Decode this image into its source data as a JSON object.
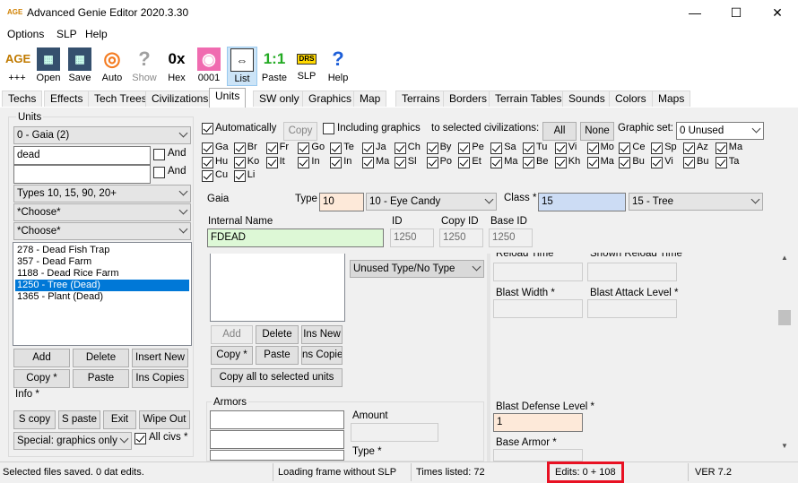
{
  "window": {
    "logo": "AGE",
    "title": "Advanced Genie Editor 2020.3.30",
    "minimize": "—",
    "maximize": "☐",
    "close": "✕"
  },
  "menu": [
    "Options",
    "SLP",
    "Help"
  ],
  "toolbar": [
    {
      "label": "+++",
      "icon": "AGE",
      "name": "age-logo-icon"
    },
    {
      "label": "Open",
      "icon": "▦",
      "name": "open-icon"
    },
    {
      "label": "Save",
      "icon": "▦",
      "name": "save-icon"
    },
    {
      "label": "Auto",
      "icon": "◎",
      "name": "lifebuoy-icon"
    },
    {
      "label": "Show",
      "icon": "?",
      "name": "question-mark-icon"
    },
    {
      "label": "Hex",
      "icon": "0x",
      "name": "hex-icon"
    },
    {
      "label": "0001",
      "icon": "◉",
      "name": "spiral-icon"
    },
    {
      "label": "List",
      "icon": "⇔",
      "name": "list-icon"
    },
    {
      "label": "Paste",
      "icon": "1:1",
      "name": "paste-icon"
    },
    {
      "label": "SLP",
      "icon": "DRS",
      "name": "slp-icon"
    },
    {
      "label": "Help",
      "icon": "?",
      "name": "help-icon"
    }
  ],
  "tabs": [
    "Techs",
    "Effects",
    "Tech Trees",
    "Civilizations",
    "Units",
    "SW only",
    "Graphics",
    "Map",
    "Terrains",
    "Borders",
    "Terrain Tables",
    "Sounds",
    "Colors",
    "Maps"
  ],
  "left": {
    "units_label": "Units",
    "civ_select": "0 - Gaia (2)",
    "search": "dead",
    "search2": "",
    "and1": "And",
    "and2": "And",
    "types": "Types 10, 15, 90, 20+",
    "choose1": "*Choose*",
    "choose2": "*Choose*",
    "units": [
      "278 - Dead Fish Trap",
      "357 - Dead Farm",
      "1188 - Dead Rice Farm",
      "1250 - Tree (Dead)",
      "1365 - Plant (Dead)"
    ],
    "buttons": {
      "add": "Add",
      "delete": "Delete",
      "insert_new": "Insert New",
      "copy": "Copy *",
      "paste": "Paste",
      "ins_copies": "Ins Copies"
    },
    "info": "Info *",
    "buttons2": {
      "s_copy": "S copy",
      "s_paste": "S paste",
      "exit": "Exit",
      "wipe_out": "Wipe Out"
    },
    "special": "Special: graphics only",
    "all_civs": "All civs *"
  },
  "civbar": {
    "automatically": "Automatically",
    "copy": "Copy",
    "including_graphics": "Including graphics",
    "to_selected": "to selected civilizations:",
    "all": "All",
    "none": "None",
    "graphic_set_label": "Graphic set:",
    "graphic_set": "0 Unused",
    "row1": [
      "Ga",
      "Br",
      "Fr",
      "Go",
      "Te",
      "Ja",
      "Ch",
      "By",
      "Pe",
      "Sa",
      "Tu",
      "Vi",
      "Mo",
      "Ce",
      "Sp",
      "Az",
      "Ma"
    ],
    "row2": [
      "Hu",
      "Ko",
      "It",
      "In",
      "In",
      "Ma",
      "Sl",
      "Po",
      "Et",
      "Ma",
      "Be",
      "Kh",
      "Ma",
      "Bu",
      "Vi",
      "Bu",
      "Ta"
    ],
    "row3": [
      "Cu",
      "Li"
    ]
  },
  "unit": {
    "civ_name": "Gaia",
    "type_label": "Type",
    "type_value": "10",
    "type_select": "10 - Eye Candy",
    "class_label": "Class *",
    "class_value": "15",
    "class_select": "15 - Tree",
    "internal_name_label": "Internal Name",
    "internal_name": "FDEAD",
    "id_label": "ID",
    "id": "1250",
    "copy_id_label": "Copy ID",
    "copy_id": "1250",
    "base_id_label": "Base ID",
    "base_id": "1250"
  },
  "mid": {
    "unused_type": "Unused Type/No Type",
    "add": "Add",
    "delete": "Delete",
    "ins_new": "Ins New",
    "copy": "Copy *",
    "paste": "Paste",
    "ins_copies": "ns Copie",
    "copy_all": "Copy all to selected units",
    "armors_label": "Armors",
    "amount_label": "Amount",
    "type_label": "Type *"
  },
  "right": {
    "reload_time": "Reload Time",
    "shown_reload_time": "Shown Reload Time",
    "blast_width": "Blast Width *",
    "blast_attack_level": "Blast Attack Level *",
    "blast_defense_level": "Blast Defense Level *",
    "blast_defense_value": "1",
    "base_armor": "Base Armor *"
  },
  "status": {
    "saved": "Selected files saved. 0 dat edits.",
    "loading": "Loading frame without SLP",
    "times": "Times listed: 72",
    "edits": "Edits: 0 + 108",
    "version": "VER 7.2"
  },
  "colors": {
    "highlight": "#e81123",
    "selection": "#0078d7"
  }
}
